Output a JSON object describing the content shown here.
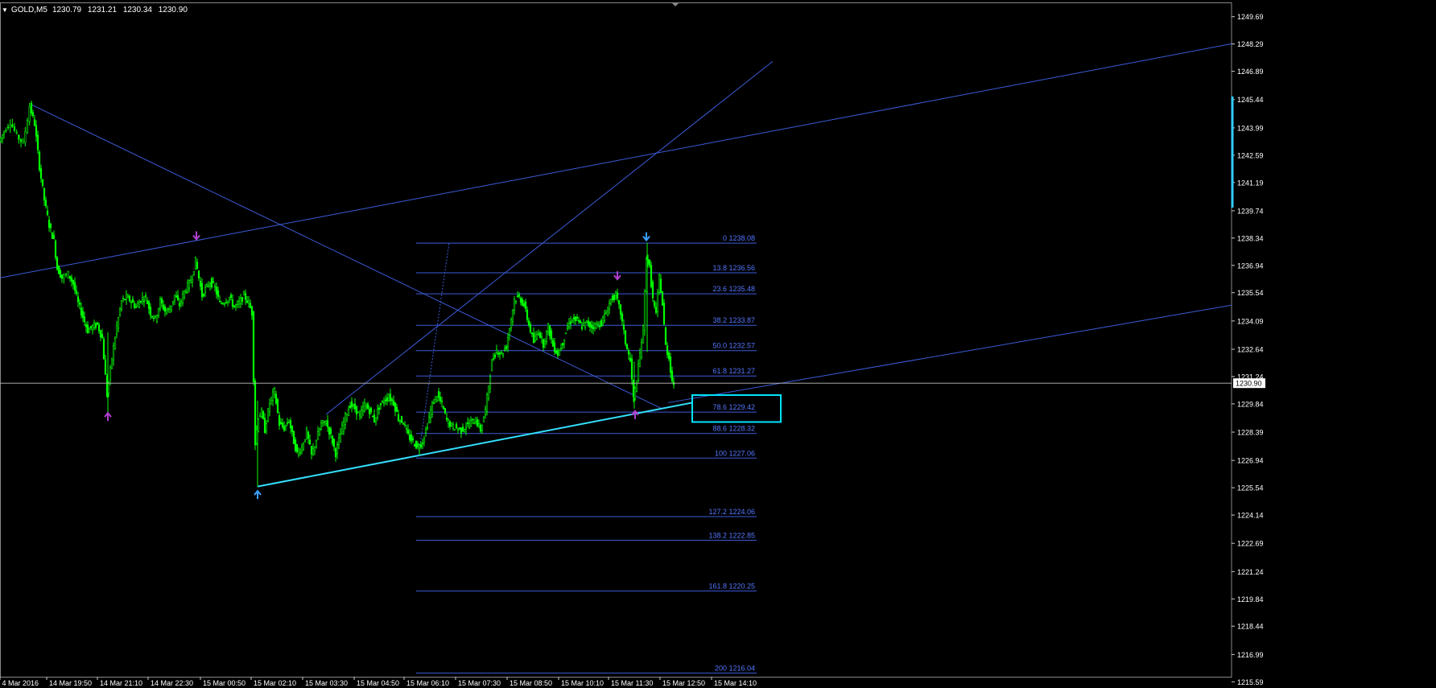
{
  "header": {
    "symbol": "GOLD,M5",
    "open": "1230.79",
    "high": "1231.21",
    "low": "1230.34",
    "close": "1230.90"
  },
  "colors": {
    "background": "#000000",
    "candle": "#00ff00",
    "axis_text": "#ffffff",
    "trendline": "#3d5bd9",
    "fib_line": "#3d5bd9",
    "fib_label": "#5577ff",
    "channel_line": "#33e0ff",
    "highlight_box": "#00e5ff",
    "arrow_up_purple": "#b040d0",
    "arrow_blue": "#3aa0ff",
    "bid_line": "#c0c0c0",
    "price_scale_marker": "#33ccff"
  },
  "chart_data": {
    "type": "candlestick",
    "title": "",
    "xlabel": "",
    "ylabel": "",
    "ylim": [
      1215.19,
      1250.38
    ],
    "x_ticks": [
      "4 Mar 2016",
      "14 Mar 19:50",
      "14 Mar 21:10",
      "14 Mar 22:30",
      "15 Mar 00:50",
      "15 Mar 02:10",
      "15 Mar 03:30",
      "15 Mar 04:50",
      "15 Mar 06:10",
      "15 Mar 07:30",
      "15 Mar 08:50",
      "15 Mar 10:10",
      "15 Mar 11:30",
      "15 Mar 12:50",
      "15 Mar 14:10"
    ],
    "y_ticks": [
      "1249.69",
      "1248.29",
      "1246.89",
      "1245.44",
      "1243.99",
      "1242.59",
      "1241.19",
      "1239.74",
      "1238.34",
      "1236.94",
      "1235.54",
      "1234.09",
      "1232.64",
      "1231.24",
      "1229.84",
      "1228.39",
      "1226.94",
      "1225.54",
      "1224.14",
      "1222.69",
      "1221.24",
      "1219.84",
      "1218.44",
      "1216.99",
      "1215.59"
    ],
    "current_price": "1230.90",
    "price_path": [
      [
        0,
        1243.3
      ],
      [
        6,
        1243.8
      ],
      [
        14,
        1244.3
      ],
      [
        22,
        1243.6
      ],
      [
        30,
        1243.2
      ],
      [
        38,
        1245.1
      ],
      [
        44,
        1244.2
      ],
      [
        50,
        1242.0
      ],
      [
        56,
        1240.3
      ],
      [
        62,
        1239.0
      ],
      [
        68,
        1238.2
      ],
      [
        72,
        1236.8
      ],
      [
        78,
        1236.3
      ],
      [
        86,
        1236.5
      ],
      [
        92,
        1236.0
      ],
      [
        98,
        1235.0
      ],
      [
        104,
        1234.3
      ],
      [
        110,
        1233.6
      ],
      [
        116,
        1233.8
      ],
      [
        122,
        1233.9
      ],
      [
        128,
        1233.2
      ],
      [
        134,
        1230.3
      ],
      [
        140,
        1232.2
      ],
      [
        146,
        1233.8
      ],
      [
        152,
        1235.1
      ],
      [
        158,
        1235.3
      ],
      [
        164,
        1235.1
      ],
      [
        170,
        1234.8
      ],
      [
        176,
        1235.2
      ],
      [
        182,
        1235.3
      ],
      [
        188,
        1234.5
      ],
      [
        194,
        1234.2
      ],
      [
        200,
        1235.1
      ],
      [
        206,
        1234.6
      ],
      [
        212,
        1234.7
      ],
      [
        218,
        1235.4
      ],
      [
        224,
        1234.9
      ],
      [
        230,
        1235.6
      ],
      [
        236,
        1236.0
      ],
      [
        240,
        1236.4
      ],
      [
        244,
        1237.2
      ],
      [
        248,
        1236.3
      ],
      [
        252,
        1235.4
      ],
      [
        256,
        1235.7
      ],
      [
        262,
        1236.1
      ],
      [
        268,
        1235.8
      ],
      [
        274,
        1235.0
      ],
      [
        280,
        1235.1
      ],
      [
        286,
        1235.3
      ],
      [
        292,
        1234.8
      ],
      [
        298,
        1235.0
      ],
      [
        304,
        1235.4
      ],
      [
        310,
        1235.0
      ],
      [
        314,
        1234.5
      ],
      [
        318,
        1227.8
      ],
      [
        322,
        1229.2
      ],
      [
        326,
        1229.4
      ],
      [
        330,
        1228.5
      ],
      [
        336,
        1229.9
      ],
      [
        342,
        1230.5
      ],
      [
        348,
        1228.8
      ],
      [
        354,
        1228.6
      ],
      [
        360,
        1229.0
      ],
      [
        366,
        1227.9
      ],
      [
        370,
        1227.3
      ],
      [
        376,
        1227.6
      ],
      [
        382,
        1228.4
      ],
      [
        388,
        1227.2
      ],
      [
        394,
        1228.0
      ],
      [
        400,
        1228.8
      ],
      [
        406,
        1228.9
      ],
      [
        412,
        1228.2
      ],
      [
        418,
        1227.3
      ],
      [
        424,
        1228.3
      ],
      [
        430,
        1229.2
      ],
      [
        436,
        1229.8
      ],
      [
        442,
        1229.6
      ],
      [
        448,
        1229.2
      ],
      [
        454,
        1229.8
      ],
      [
        460,
        1229.5
      ],
      [
        466,
        1229.0
      ],
      [
        472,
        1229.7
      ],
      [
        478,
        1230.0
      ],
      [
        484,
        1230.2
      ],
      [
        490,
        1229.9
      ],
      [
        496,
        1229.1
      ],
      [
        502,
        1228.9
      ],
      [
        508,
        1228.2
      ],
      [
        514,
        1227.9
      ],
      [
        520,
        1227.6
      ],
      [
        526,
        1227.9
      ],
      [
        532,
        1228.8
      ],
      [
        538,
        1229.8
      ],
      [
        544,
        1230.3
      ],
      [
        550,
        1229.8
      ],
      [
        556,
        1229.0
      ],
      [
        562,
        1228.7
      ],
      [
        568,
        1228.6
      ],
      [
        574,
        1228.5
      ],
      [
        580,
        1228.7
      ],
      [
        586,
        1228.9
      ],
      [
        592,
        1229.0
      ],
      [
        598,
        1228.5
      ],
      [
        604,
        1229.5
      ],
      [
        608,
        1230.8
      ],
      [
        612,
        1232.0
      ],
      [
        618,
        1232.6
      ],
      [
        624,
        1232.4
      ],
      [
        630,
        1232.8
      ],
      [
        636,
        1234.2
      ],
      [
        640,
        1235.2
      ],
      [
        646,
        1235.3
      ],
      [
        652,
        1234.9
      ],
      [
        658,
        1233.9
      ],
      [
        664,
        1233.0
      ],
      [
        670,
        1233.6
      ],
      [
        676,
        1232.9
      ],
      [
        682,
        1233.8
      ],
      [
        688,
        1232.8
      ],
      [
        694,
        1232.4
      ],
      [
        700,
        1233.0
      ],
      [
        706,
        1233.8
      ],
      [
        712,
        1234.2
      ],
      [
        718,
        1234.1
      ],
      [
        724,
        1233.8
      ],
      [
        730,
        1234.0
      ],
      [
        736,
        1233.8
      ],
      [
        742,
        1233.9
      ],
      [
        748,
        1234.0
      ],
      [
        754,
        1234.5
      ],
      [
        760,
        1235.2
      ],
      [
        766,
        1235.4
      ],
      [
        772,
        1234.5
      ],
      [
        778,
        1233.0
      ],
      [
        784,
        1232.0
      ],
      [
        788,
        1230.1
      ],
      [
        792,
        1231.0
      ],
      [
        796,
        1232.4
      ],
      [
        800,
        1233.7
      ],
      [
        804,
        1237.4
      ],
      [
        808,
        1236.8
      ],
      [
        812,
        1235.2
      ],
      [
        816,
        1234.4
      ],
      [
        820,
        1236.4
      ],
      [
        824,
        1234.9
      ],
      [
        828,
        1232.8
      ],
      [
        832,
        1232.2
      ],
      [
        836,
        1231.0
      ],
      [
        838,
        1230.9
      ]
    ],
    "fibonacci": {
      "levels": [
        {
          "label": "0 1238.08",
          "price": 1238.08
        },
        {
          "label": "13.8 1236.56",
          "price": 1236.56
        },
        {
          "label": "23.6 1235.48",
          "price": 1235.48
        },
        {
          "label": "38.2 1233.87",
          "price": 1233.87
        },
        {
          "label": "50.0 1232.57",
          "price": 1232.57
        },
        {
          "label": "61.8 1231.27",
          "price": 1231.27
        },
        {
          "label": "78.6 1229.42",
          "price": 1229.42
        },
        {
          "label": "88.6 1228.32",
          "price": 1228.32
        },
        {
          "label": "100 1227.06",
          "price": 1227.06
        },
        {
          "label": "127.2 1224.06",
          "price": 1224.06
        },
        {
          "label": "138.2 1222.85",
          "price": 1222.85
        },
        {
          "label": "161.8 1220.25",
          "price": 1220.25
        },
        {
          "label": "200 1216.04",
          "price": 1216.04
        }
      ]
    },
    "trendlines": [
      {
        "style": "thin",
        "from": [
          0,
          1236.3
        ],
        "to": [
          1530,
          1248.3
        ]
      },
      {
        "style": "thin",
        "from": [
          38,
          1245.2
        ],
        "to": [
          822,
          1229.6
        ]
      },
      {
        "style": "thin",
        "from": [
          405,
          1229.3
        ],
        "to": [
          960,
          1247.4
        ]
      },
      {
        "style": "thin",
        "from": [
          830,
          1229.9
        ],
        "to": [
          1530,
          1234.9
        ]
      },
      {
        "style": "thick",
        "from": [
          320,
          1225.6
        ],
        "to": [
          860,
          1229.9
        ]
      },
      {
        "style": "dotted",
        "from": [
          520,
          1227.2
        ],
        "to": [
          558,
          1238.1
        ]
      }
    ],
    "arrows": [
      {
        "dir": "down",
        "color": "purple",
        "x": 244,
        "price": 1238.15
      },
      {
        "dir": "up",
        "color": "purple",
        "x": 134,
        "price": 1229.5
      },
      {
        "dir": "up",
        "color": "blue",
        "x": 320,
        "price": 1225.5
      },
      {
        "dir": "down",
        "color": "blue",
        "x": 803,
        "price": 1238.1
      },
      {
        "dir": "down",
        "color": "purple",
        "x": 767,
        "price": 1236.1
      },
      {
        "dir": "up",
        "color": "purple",
        "x": 789,
        "price": 1229.6
      }
    ],
    "grid": false
  }
}
